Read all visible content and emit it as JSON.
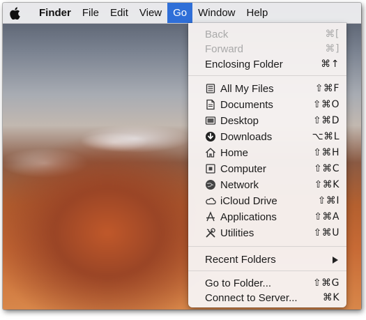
{
  "menubar": {
    "apple_icon": "apple-logo-icon",
    "items": [
      "Finder",
      "File",
      "Edit",
      "View",
      "Go",
      "Window",
      "Help"
    ],
    "active": "Go"
  },
  "go_menu": {
    "nav": [
      {
        "label": "Back",
        "shortcut": "⌘[",
        "enabled": false
      },
      {
        "label": "Forward",
        "shortcut": "⌘]",
        "enabled": false
      },
      {
        "label": "Enclosing Folder",
        "shortcut": "⌘↑",
        "enabled": true
      }
    ],
    "places": [
      {
        "label": "All My Files",
        "shortcut": "⇧⌘F",
        "icon": "all-files-icon"
      },
      {
        "label": "Documents",
        "shortcut": "⇧⌘O",
        "icon": "documents-icon"
      },
      {
        "label": "Desktop",
        "shortcut": "⇧⌘D",
        "icon": "desktop-icon"
      },
      {
        "label": "Downloads",
        "shortcut": "⌥⌘L",
        "icon": "downloads-icon"
      },
      {
        "label": "Home",
        "shortcut": "⇧⌘H",
        "icon": "home-icon"
      },
      {
        "label": "Computer",
        "shortcut": "⇧⌘C",
        "icon": "computer-icon"
      },
      {
        "label": "Network",
        "shortcut": "⇧⌘K",
        "icon": "network-icon"
      },
      {
        "label": "iCloud Drive",
        "shortcut": "⇧⌘I",
        "icon": "icloud-icon"
      },
      {
        "label": "Applications",
        "shortcut": "⇧⌘A",
        "icon": "applications-icon"
      },
      {
        "label": "Utilities",
        "shortcut": "⇧⌘U",
        "icon": "utilities-icon"
      }
    ],
    "recent_folders": {
      "label": "Recent Folders",
      "submenu_icon": "chevron-right-icon"
    },
    "server": [
      {
        "label": "Go to Folder...",
        "shortcut": "⇧⌘G"
      },
      {
        "label": "Connect to Server...",
        "shortcut": "⌘K"
      }
    ]
  },
  "colors": {
    "menubar_bg": "#eeeef0",
    "highlight": "#2f6fd8",
    "menu_bg": "#f6f2f1",
    "disabled_text": "#a9a9a9"
  }
}
